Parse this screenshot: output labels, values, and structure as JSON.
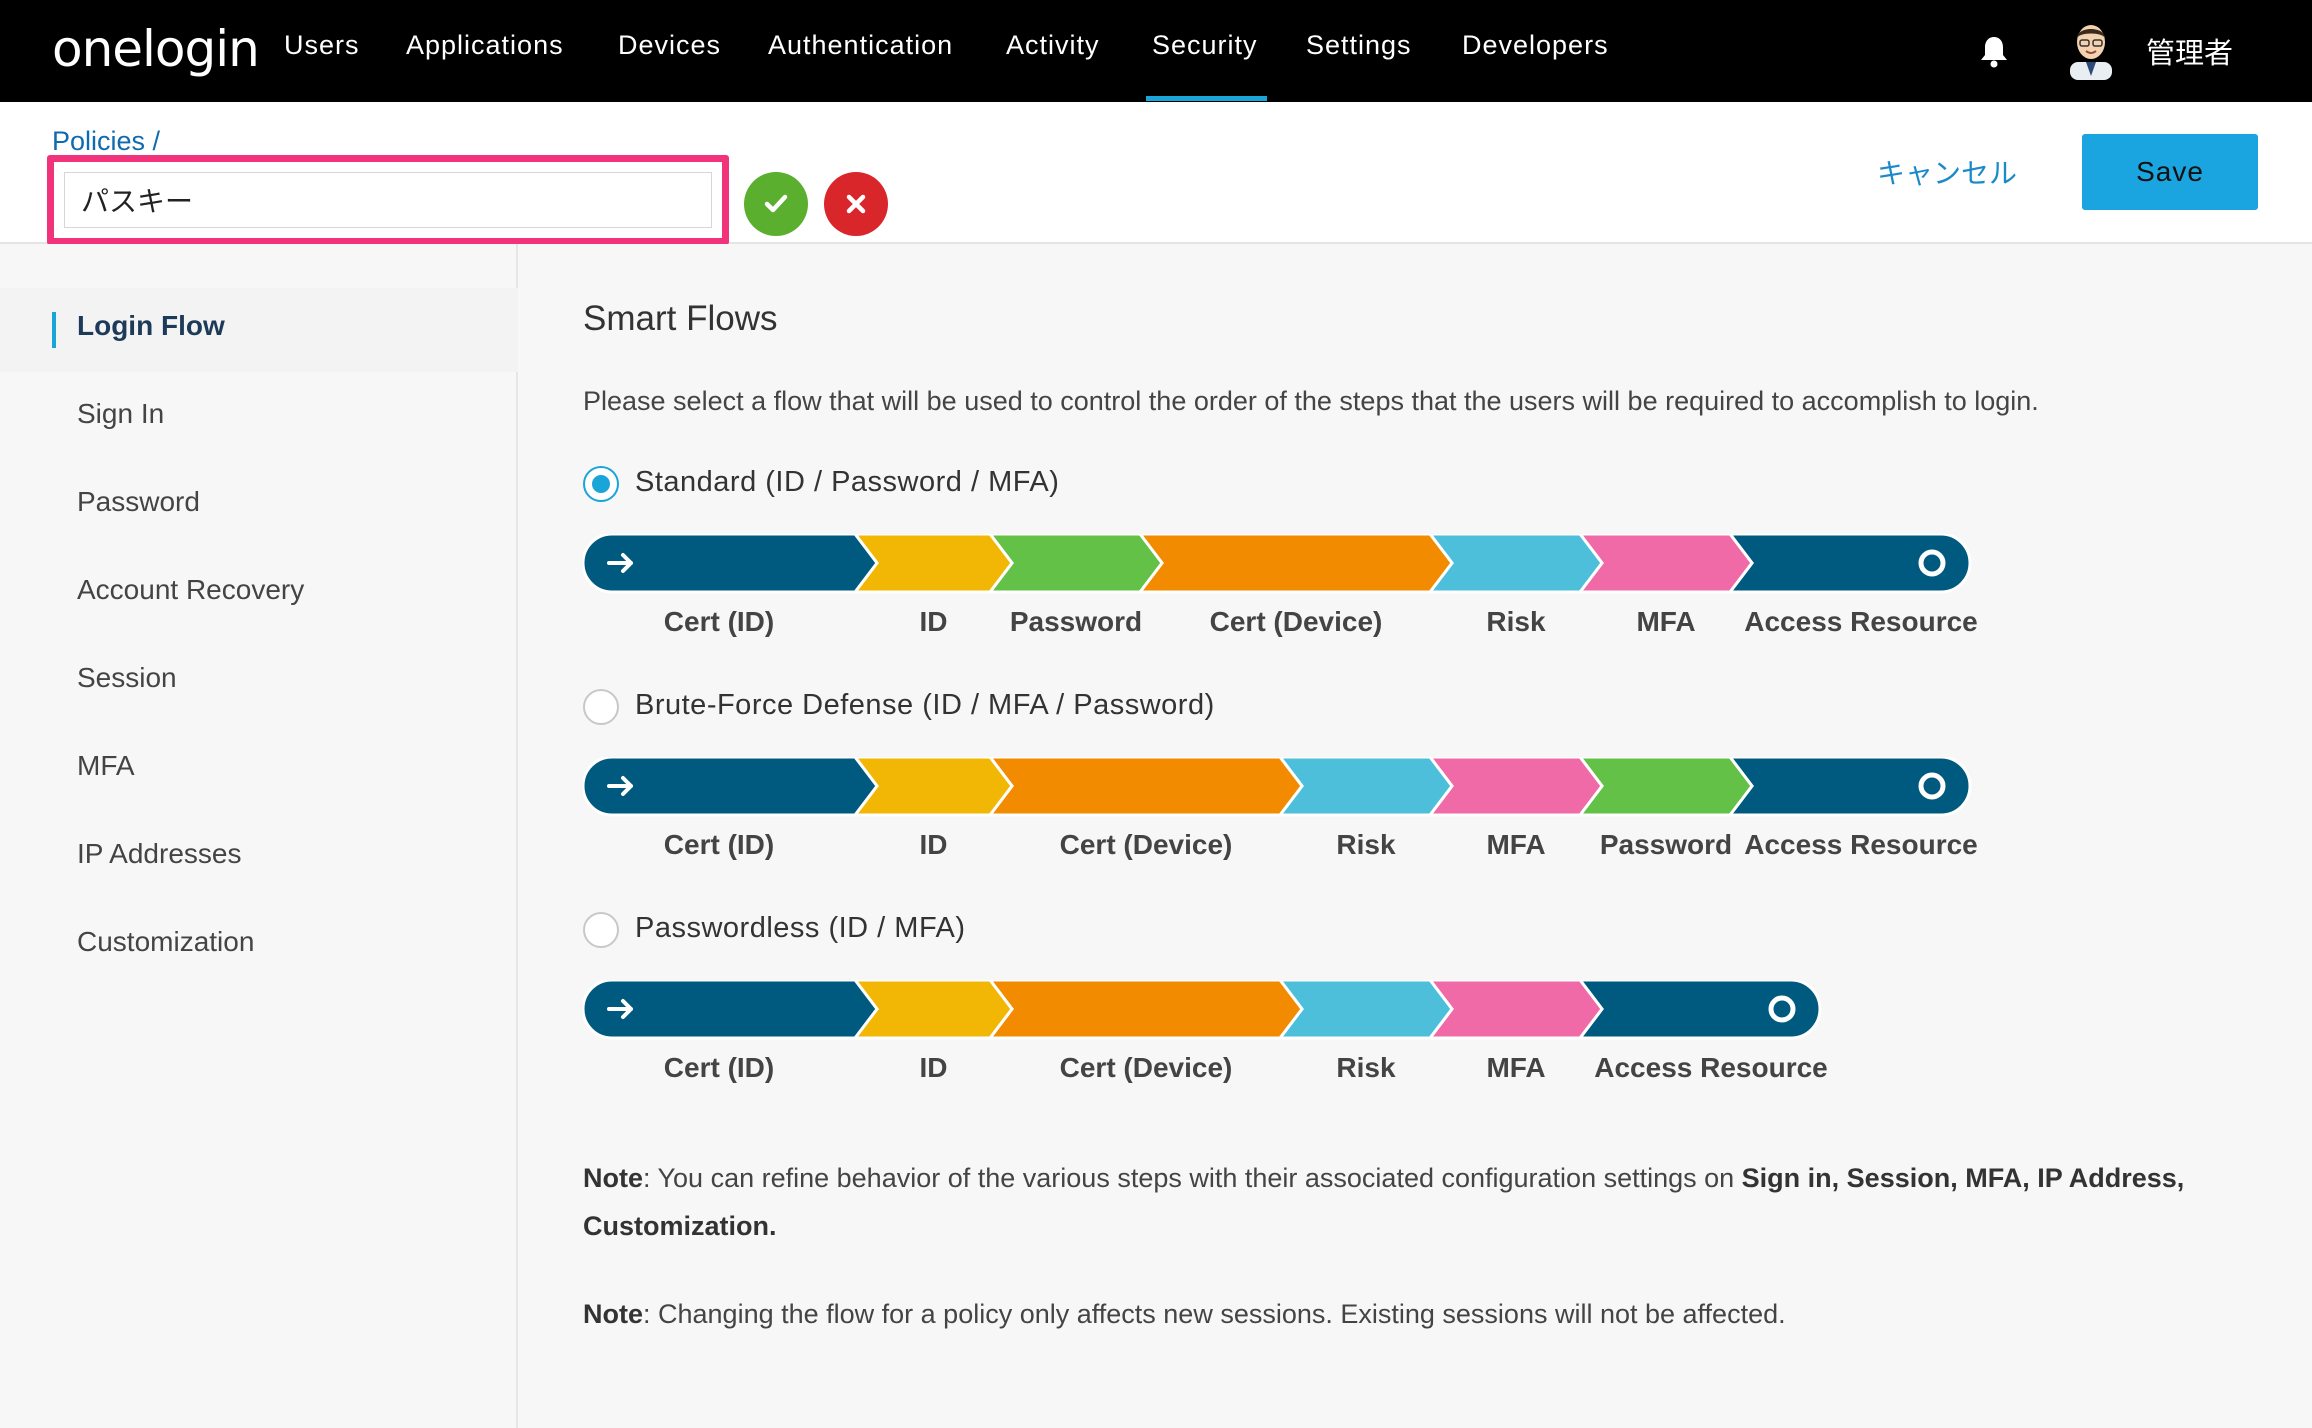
{
  "nav": {
    "logo": "onelogin",
    "items": [
      "Users",
      "Applications",
      "Devices",
      "Authentication",
      "Activity",
      "Security",
      "Settings",
      "Developers"
    ],
    "active": "Security",
    "user": "管理者"
  },
  "header": {
    "breadcrumb": "Policies /",
    "policy_name": "パスキー",
    "cancel_label": "キャンセル",
    "save_label": "Save"
  },
  "sidebar": {
    "items": [
      "Login Flow",
      "Sign In",
      "Password",
      "Account Recovery",
      "Session",
      "MFA",
      "IP Addresses",
      "Customization"
    ],
    "active": "Login Flow"
  },
  "main": {
    "title": "Smart Flows",
    "description": "Please select a flow that will be used to control the order of the steps that the users will be required to accomplish to login.",
    "flows": [
      {
        "label": "Standard (ID / Password / MFA)",
        "selected": true,
        "steps": [
          "Cert (ID)",
          "ID",
          "Password",
          "Cert (Device)",
          "Risk",
          "MFA",
          "Access Resource"
        ],
        "colors": [
          "#005a7f",
          "#f2b705",
          "#62c146",
          "#f28b00",
          "#4dbfda",
          "#f06aa8",
          "#005a7f"
        ]
      },
      {
        "label": "Brute-Force Defense (ID / MFA / Password)",
        "selected": false,
        "steps": [
          "Cert (ID)",
          "ID",
          "Cert (Device)",
          "Risk",
          "MFA",
          "Password",
          "Access Resource"
        ],
        "colors": [
          "#005a7f",
          "#f2b705",
          "#f28b00",
          "#4dbfda",
          "#f06aa8",
          "#62c146",
          "#005a7f"
        ]
      },
      {
        "label": "Passwordless (ID / MFA)",
        "selected": false,
        "steps": [
          "Cert (ID)",
          "ID",
          "Cert (Device)",
          "Risk",
          "MFA",
          "Access Resource"
        ],
        "colors": [
          "#005a7f",
          "#f2b705",
          "#f28b00",
          "#4dbfda",
          "#f06aa8",
          "#005a7f"
        ]
      }
    ],
    "note1_label": "Note",
    "note1_text": ": You can refine behavior of the various steps with their associated configuration settings on ",
    "note1_bold": "Sign in, Session, MFA, IP Address, Customization.",
    "note2_label": "Note",
    "note2_text": ": Changing the flow for a policy only affects new sessions. Existing sessions will not be affected."
  }
}
